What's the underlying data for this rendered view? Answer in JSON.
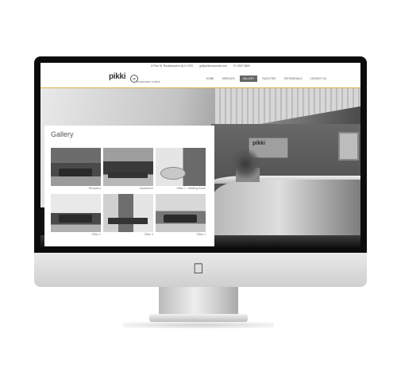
{
  "site": {
    "contact": {
      "address": "8 Pike St, Rockhampton QLD 4700",
      "email": "gt@pikkicorporate.com",
      "phone": "07 4922 3800"
    },
    "logo": {
      "name": "pikki",
      "badge": "gt",
      "tagline": "corporate centre"
    },
    "nav": [
      {
        "label": "HOME",
        "active": false
      },
      {
        "label": "SERVICES",
        "active": false
      },
      {
        "label": "GALLERY",
        "active": true
      },
      {
        "label": "FACILITIES",
        "active": false
      },
      {
        "label": "TESTIMONIALS",
        "active": false
      },
      {
        "label": "CONTACT US",
        "active": false
      }
    ],
    "gallery": {
      "title": "Gallery",
      "items": [
        {
          "caption": "Reception"
        },
        {
          "caption": "Boardroom"
        },
        {
          "caption": "Office 1 - Meeting Room"
        },
        {
          "caption": "Office 2"
        },
        {
          "caption": "Office 3"
        },
        {
          "caption": "Office 4"
        }
      ]
    }
  },
  "device": {
    "logo_icon": "apple-icon"
  },
  "colors": {
    "accent": "#d8b64a",
    "nav_active": "#666666",
    "bezel": "#0c0c0c"
  }
}
